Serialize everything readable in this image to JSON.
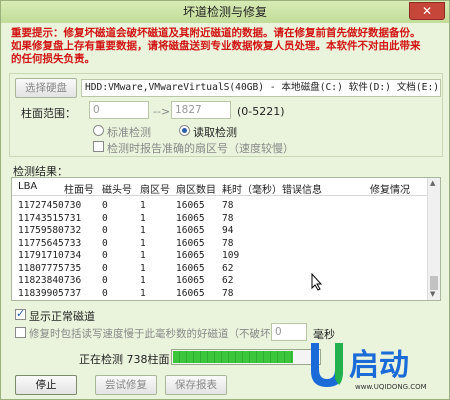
{
  "window": {
    "title": "坏道检测与修复",
    "close_symbol": "✕"
  },
  "warning": {
    "lines": [
      "重要提示：修复坏磁道会破坏磁道及其附近磁道的数据。请在修复前首先做好数据备份。",
      "如果修复盘上存有重要数据，请将磁盘送到专业数据恢复人员处理。本软件不对由此带来",
      "的任何损失负责。"
    ]
  },
  "disk": {
    "select_button": "选择硬盘",
    "info": "HDD:VMware,VMwareVirtualS(40GB) - 本地磁盘(C:) 软件(D:) 文档(E:)"
  },
  "cylinder": {
    "label": "柱面范围：",
    "from": "0",
    "arrow": "-->",
    "to": "1827",
    "range": "(0-5221)"
  },
  "modes": {
    "standard": "标准检测",
    "read": "读取检测",
    "repair_while_check": "检测时报告准确的扇区号（速度较慢）"
  },
  "results": {
    "label": "检测结果：",
    "columns": [
      "LBA",
      "柱面号",
      "磁头号",
      "扇区号",
      "扇区数目",
      "耗时（毫秒）",
      "错误信息",
      "修复情况"
    ],
    "rows": [
      [
        "11727450",
        "730",
        "0",
        "1",
        "16065",
        "78",
        "",
        ""
      ],
      [
        "11743515",
        "731",
        "0",
        "1",
        "16065",
        "78",
        "",
        ""
      ],
      [
        "11759580",
        "732",
        "0",
        "1",
        "16065",
        "94",
        "",
        ""
      ],
      [
        "11775645",
        "733",
        "0",
        "1",
        "16065",
        "78",
        "",
        ""
      ],
      [
        "11791710",
        "734",
        "0",
        "1",
        "16065",
        "109",
        "",
        ""
      ],
      [
        "11807775",
        "735",
        "0",
        "1",
        "16065",
        "62",
        "",
        ""
      ],
      [
        "11823840",
        "736",
        "0",
        "1",
        "16065",
        "62",
        "",
        ""
      ],
      [
        "11839905",
        "737",
        "0",
        "1",
        "16065",
        "78",
        "",
        ""
      ]
    ]
  },
  "options": {
    "show_normal": "显示正常磁道",
    "repair_slow": "修复时包括读写速度慢于此毫秒数的好磁道（不破坏数据）：",
    "ms_value": "0",
    "ms_unit": "毫秒"
  },
  "status": {
    "text": "正在检测 738柱面",
    "progress_fraction": 0.82
  },
  "buttons": {
    "stop": "停止",
    "try_repair": "尝试修复",
    "save_report": "保存报表"
  },
  "logo": {
    "text": "U启动",
    "url": "www.UQIDONG.COM"
  },
  "colors": {
    "warning": "#d21414",
    "progress": "#3cc63c",
    "logo_blue": "#1a6ad8",
    "logo_green": "#22b14c"
  }
}
